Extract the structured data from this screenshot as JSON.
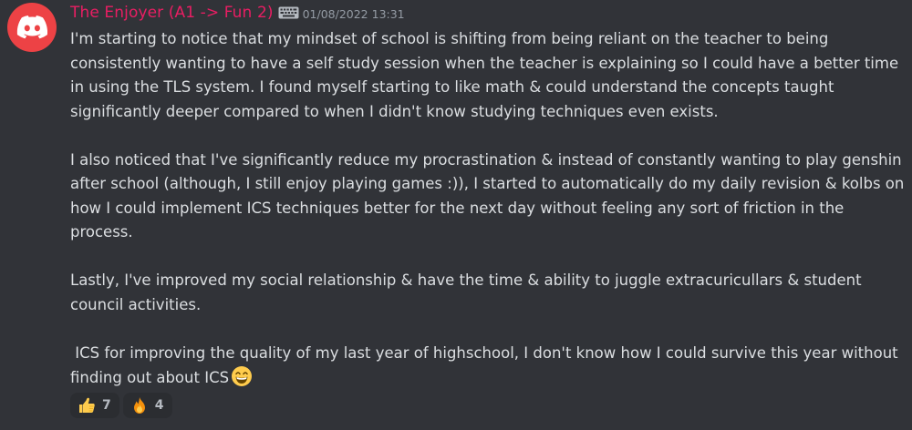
{
  "message": {
    "author": "The Enjoyer (A1 -> Fun 2)",
    "author_color": "#e91e63",
    "badge_icon": "keyboard-icon",
    "timestamp": "01/08/2022 13:31",
    "avatar_icon": "discord-logo-icon",
    "avatar_color": "#ed4245",
    "paragraphs": [
      "I'm starting to notice that my mindset of school is shifting from being reliant on the teacher to being consistently wanting to have a self study session when the teacher is explaining so I could have a better time in using the TLS system. I found myself starting to like math & could understand the concepts taught significantly deeper compared to when I didn't know studying techniques even exists.",
      "I also noticed that I've significantly reduce my procrastination & instead of constantly wanting to play genshin after school (although, I still enjoy playing games :)), I started to automatically do my daily revision & kolbs on how I could implement ICS techniques better for the next day without feeling any sort of friction in the process.",
      "Lastly, I've improved my social relationship & have the time & ability to juggle extracuricullars & student council activities.",
      " ICS for improving the quality of my last year of highschool, I don't know how I could survive this year without finding out about ICS"
    ],
    "trailing_emoji": "grinning-face-icon"
  },
  "reactions": [
    {
      "emoji": "thumbs-up-icon",
      "count": "7"
    },
    {
      "emoji": "fire-icon",
      "count": "4"
    }
  ]
}
